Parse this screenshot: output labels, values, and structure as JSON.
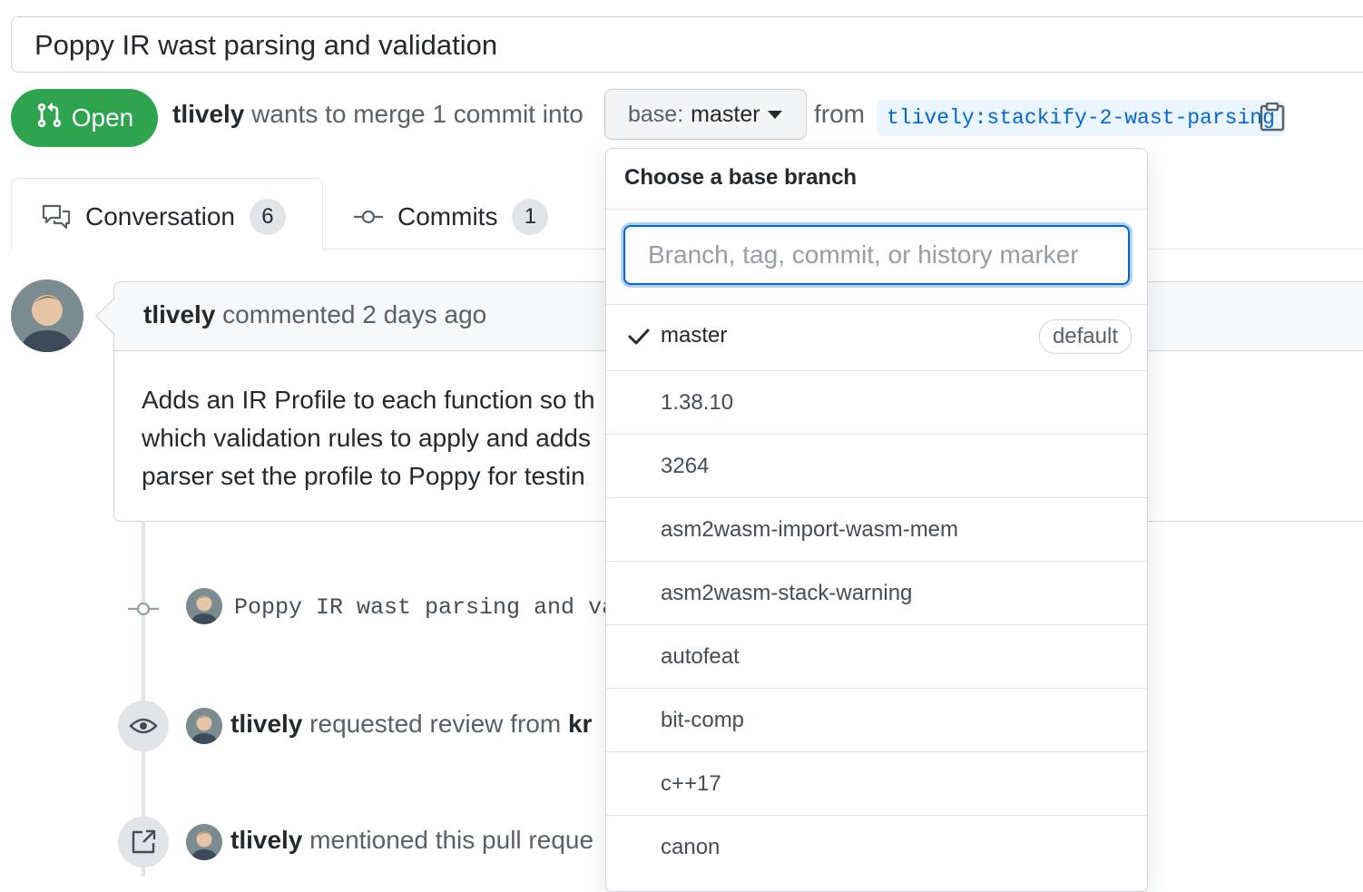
{
  "pr": {
    "title": "Poppy IR wast parsing and validation",
    "status": "Open",
    "author": "tlively",
    "merge_text": "wants to merge 1 commit into",
    "base_prefix": "base:",
    "base_value": "master",
    "from_text": "from",
    "head_ref": "tlively:stackify-2-wast-parsing"
  },
  "tabs": [
    {
      "label": "Conversation",
      "count": "6"
    },
    {
      "label": "Commits",
      "count": "1"
    }
  ],
  "comment": {
    "author": "tlively",
    "meta": "commented 2 days ago",
    "body_lines": [
      "Adds an IR Profile to each function so th",
      "which validation rules to apply and adds",
      "parser set the profile to Poppy for testin"
    ]
  },
  "timeline": {
    "commit_message": "Poppy IR wast parsing and va",
    "review_author": "tlively",
    "review_text": "requested review from",
    "review_target": "kr",
    "mention_author": "tlively",
    "mention_text": "mentioned this pull reque"
  },
  "dropdown": {
    "title": "Choose a base branch",
    "placeholder": "Branch, tag, commit, or history marker",
    "default_badge": "default",
    "branches": [
      {
        "name": "master",
        "selected": true
      },
      {
        "name": "1.38.10",
        "selected": false
      },
      {
        "name": "3264",
        "selected": false
      },
      {
        "name": "asm2wasm-import-wasm-mem",
        "selected": false
      },
      {
        "name": "asm2wasm-stack-warning",
        "selected": false
      },
      {
        "name": "autofeat",
        "selected": false
      },
      {
        "name": "bit-comp",
        "selected": false
      },
      {
        "name": "c++17",
        "selected": false
      },
      {
        "name": "canon",
        "selected": false
      }
    ]
  },
  "colors": {
    "open_green": "#2ea44f",
    "link_blue": "#0366d6",
    "ref_bg": "#eaf5ff"
  }
}
